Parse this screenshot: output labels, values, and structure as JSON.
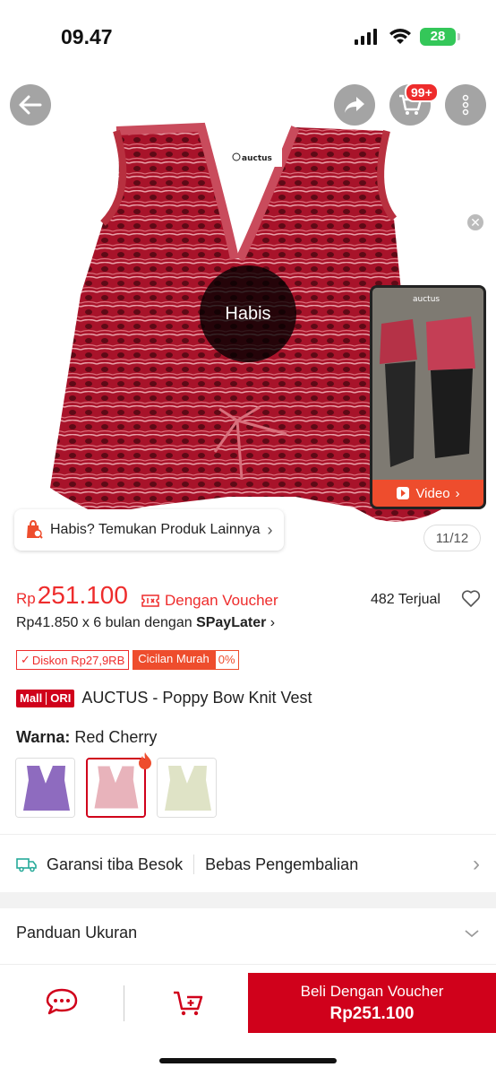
{
  "status_bar": {
    "time": "09.47",
    "battery": "28"
  },
  "header": {
    "cart_badge": "99+"
  },
  "hero": {
    "sold_out_label": "Habis",
    "video_button_label": "Video",
    "video_watermark": "auctus",
    "find_products_label": "Habis? Temukan Produk Lainnya",
    "image_counter": "11/12",
    "tag_brand": "auctus"
  },
  "price": {
    "currency": "Rp",
    "value": "251.100",
    "voucher_label": "Dengan Voucher",
    "sold_count": "482 Terjual",
    "paylater_prefix": "Rp41.850 x 6 bulan dengan ",
    "paylater_brand": "SPayLater"
  },
  "badges": {
    "discount": "Diskon Rp27,9RB",
    "installment": "Cicilan Murah",
    "installment_rate": "0%"
  },
  "product": {
    "mall_label": "Mall",
    "ori_label": "ORI",
    "title": "AUCTUS - Poppy Bow Knit Vest",
    "color_label": "Warna:",
    "color_value": "Red Cherry",
    "variants": [
      {
        "name": "Purple",
        "color": "#8e6bbf"
      },
      {
        "name": "Red Cherry",
        "color": "#e8b3bb"
      },
      {
        "name": "Cream",
        "color": "#dfe3c6"
      }
    ]
  },
  "shipping": {
    "guarantee": "Garansi tiba Besok",
    "returns": "Bebas Pengembalian"
  },
  "size_guide": {
    "label": "Panduan Ukuran"
  },
  "bottom_bar": {
    "buy_line1": "Beli Dengan Voucher",
    "buy_line2": "Rp251.100"
  },
  "colors": {
    "accent": "#d0011b",
    "shopee_orange": "#ee4d2d",
    "price_red": "#ee2c2c"
  }
}
